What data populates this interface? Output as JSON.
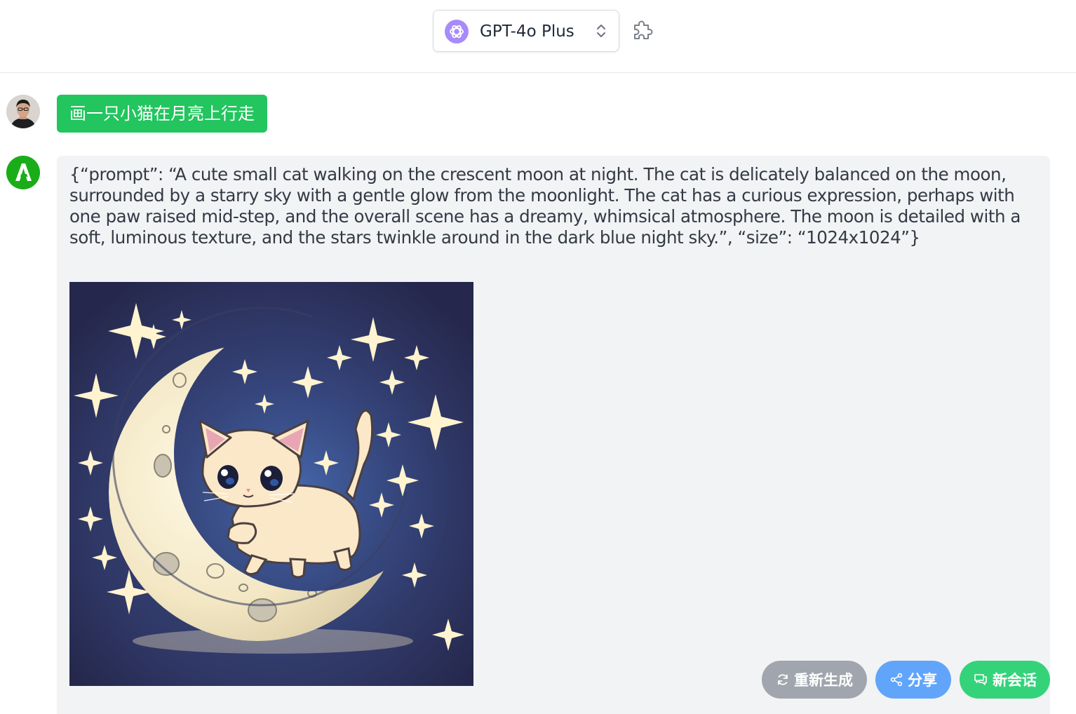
{
  "header": {
    "model_name": "GPT-4o Plus",
    "model_icon": "openai-logo-icon",
    "plugin_icon": "puzzle-icon"
  },
  "conversation": {
    "user_message": "画一只小猫在月亮上行走",
    "assistant_message": "{“prompt”: “A cute small cat walking on the crescent moon at night. The cat is delicately balanced on the moon, surrounded by a starry sky with a gentle glow from the moonlight. The cat has a curious expression, perhaps with one paw raised mid-step, and the overall scene has a dreamy, whimsical atmosphere. The moon is detailed with a soft, luminous texture, and the stars twinkle around in the dark blue night sky.”, “size”: “1024x1024”}",
    "image_subject": "cat walking on crescent moon"
  },
  "actions": {
    "regenerate": "重新生成",
    "share": "分享",
    "new_chat": "新会话"
  },
  "colors": {
    "user_bubble": "#22c55e",
    "assistant_bubble": "#f2f3f5",
    "regenerate_button": "#a1a5ad",
    "share_button": "#60a5fa",
    "new_chat_button": "#34d37a"
  }
}
